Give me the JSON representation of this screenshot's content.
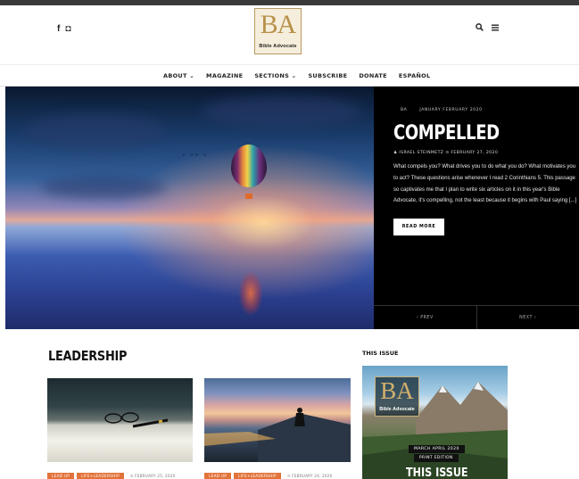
{
  "header": {
    "social": {
      "facebook": "f",
      "instagram": "◘"
    },
    "logo": {
      "mark": "BA",
      "subtitle": "Bible Advocate"
    },
    "icons": [
      "search-icon",
      "menu-icon"
    ]
  },
  "nav": {
    "items": [
      {
        "label": "ABOUT ⌄"
      },
      {
        "label": "MAGAZINE"
      },
      {
        "label": "SECTIONS ⌄"
      },
      {
        "label": "SUBSCRIBE"
      },
      {
        "label": "DONATE"
      },
      {
        "label": "ESPAÑOL"
      }
    ]
  },
  "hero": {
    "category": "BA",
    "issue": "JANUARY FEBRUARY 2020",
    "title": "COMPELLED",
    "author_line": "♟ ISRAEL STEINMETZ ⊙ FEBRUARY 27, 2020",
    "excerpt": "What compels you? What drives you to do what you do? What motivates you to act? These questions arise whenever I read 2 Corinthians 5. This passage so captivates me that I plan to write six articles on it in this year's Bible Advocate, it's compelling, not the least because it begins with Paul saying [...]",
    "read_more": "READ MORE",
    "prev": "‹ PREV",
    "next": "NEXT ›"
  },
  "leadership": {
    "title": "LEADERSHIP",
    "cards": [
      {
        "tags": [
          "LEAD UP",
          "LIFE+LEADERSHIP"
        ],
        "date": "⊙ FEBRUARY 25, 2020"
      },
      {
        "tags": [
          "LEAD UP",
          "LIFE+LEADERSHIP"
        ],
        "date": "⊙ FEBRUARY 24, 2020"
      }
    ]
  },
  "this_issue": {
    "label": "THIS ISSUE",
    "cover": {
      "mark": "BA",
      "subtitle": "Bible Advocate",
      "date": "MARCH APRIL 2020",
      "edition": "PRINT EDITION",
      "title": "THIS ISSUE"
    }
  },
  "colors": {
    "accent": "#e2733a",
    "dark_panel": "#000000"
  }
}
